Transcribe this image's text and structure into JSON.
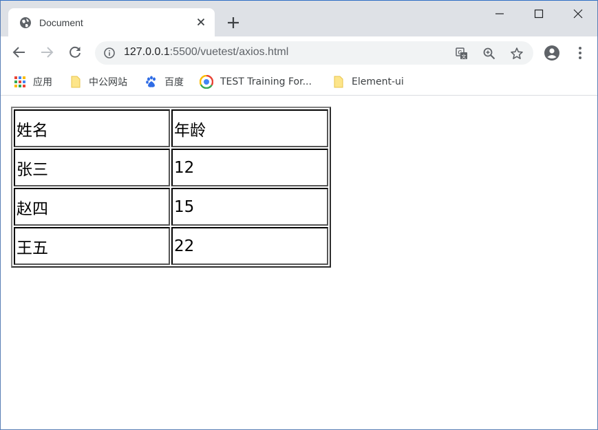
{
  "tab": {
    "title": "Document",
    "favicon": "globe-icon"
  },
  "address_bar": {
    "url_host": "127.0.0.1",
    "url_rest": ":5500/vuetest/axios.html"
  },
  "bookmarks": [
    {
      "label": "应用",
      "icon": "apps-grid-icon"
    },
    {
      "label": "中公网站",
      "icon": "folder-icon"
    },
    {
      "label": "百度",
      "icon": "baidu-paw-icon"
    },
    {
      "label": "TEST Training For...",
      "icon": "site-logo-icon"
    },
    {
      "label": "Element-ui",
      "icon": "folder-icon"
    }
  ],
  "table": {
    "rows": [
      [
        "姓名",
        "年龄"
      ],
      [
        "张三",
        "12"
      ],
      [
        "赵四",
        "15"
      ],
      [
        "王五",
        "22"
      ]
    ]
  },
  "colors": {
    "tabstrip_bg": "#dee1e6",
    "omnibox_bg": "#f1f3f4",
    "icon_gray": "#5f6368"
  }
}
